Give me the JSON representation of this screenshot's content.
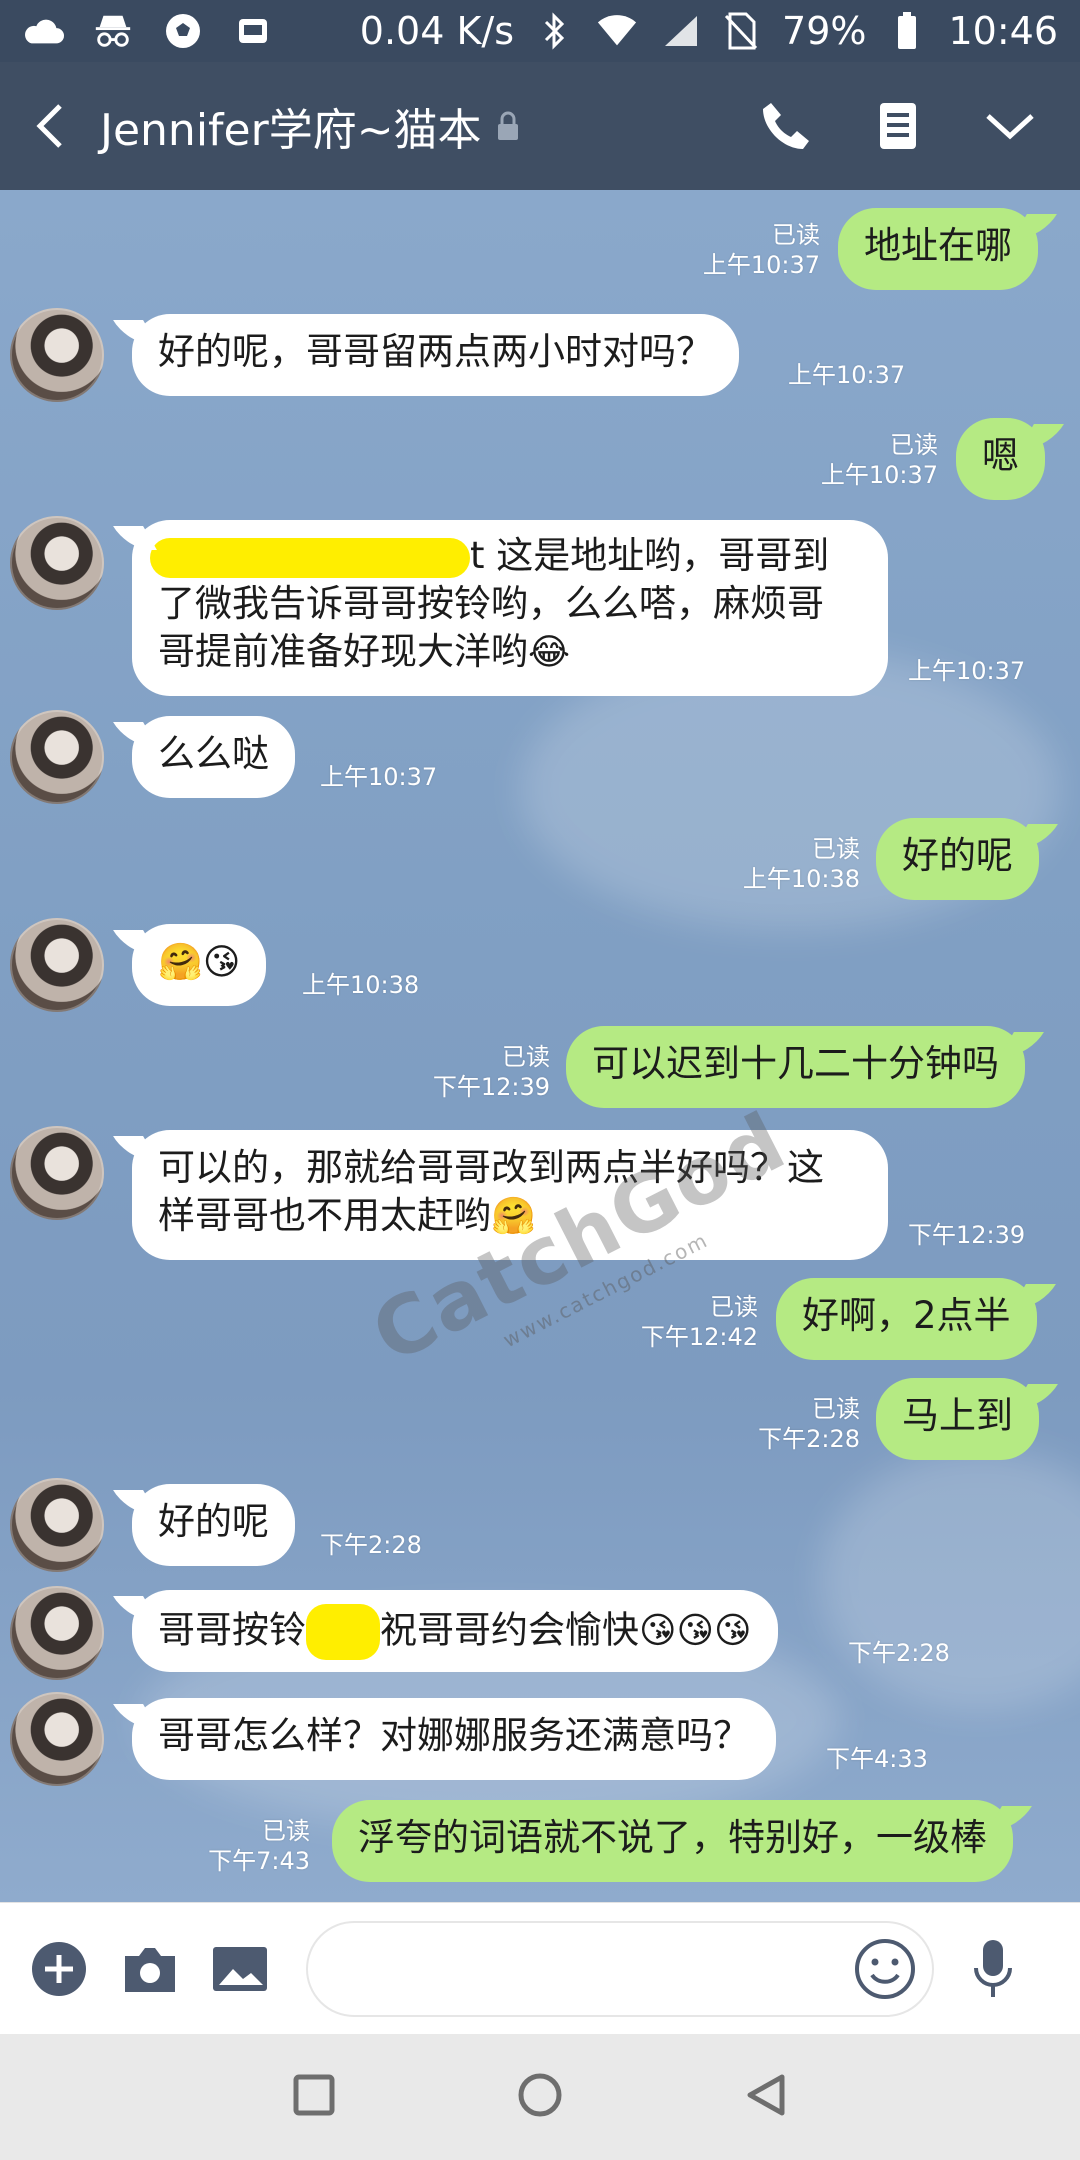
{
  "status_bar": {
    "net_speed": "0.04 K/s",
    "battery": "79%",
    "time": "10:46",
    "left_icons": [
      "cloud-icon",
      "incognito-icon",
      "soccer-ball-icon",
      "mail-icon"
    ]
  },
  "header": {
    "title": "Jennifer学府~猫本"
  },
  "messages": [
    {
      "side": "out",
      "text": "地址在哪",
      "read": "已读",
      "time": "上午10:37"
    },
    {
      "side": "in",
      "text": "好的呢，哥哥留两点两小时对吗？",
      "time": "上午10:37"
    },
    {
      "side": "out",
      "text": "嗯",
      "read": "已读",
      "time": "上午10:37"
    },
    {
      "side": "in",
      "text_line1_tail": "t 这是地址哟，哥哥到",
      "text_line2": "了微我告诉哥哥按铃哟，么么嗒，麻烦哥",
      "text_line3": "哥提前准备好现大洋哟",
      "emoji": "😂",
      "time": "上午10:37"
    },
    {
      "side": "in",
      "text": "么么哒",
      "time": "上午10:37"
    },
    {
      "side": "out",
      "text": "好的呢",
      "read": "已读",
      "time": "上午10:38"
    },
    {
      "side": "in",
      "text": "🤗😘",
      "time": "上午10:38"
    },
    {
      "side": "out",
      "text": "可以迟到十几二十分钟吗",
      "read": "已读",
      "time": "下午12:39"
    },
    {
      "side": "in",
      "text_line1": "可以的，那就给哥哥改到两点半好吗？这",
      "text_line2": "样哥哥也不用太赶哟",
      "emoji": "🤗",
      "time": "下午12:39"
    },
    {
      "side": "out",
      "text": "好啊，2点半",
      "read": "已读",
      "time": "下午12:42"
    },
    {
      "side": "out",
      "text": "马上到",
      "read": "已读",
      "time": "下午2:28"
    },
    {
      "side": "in",
      "text": "好的呢",
      "time": "下午2:28"
    },
    {
      "side": "in",
      "text_head": "哥哥按铃",
      "text_tail": "祝哥哥约会愉快",
      "emoji": "😘😘😘",
      "time": "下午2:28"
    },
    {
      "side": "in",
      "text": "哥哥怎么样？对娜娜服务还满意吗？",
      "time": "下午4:33"
    },
    {
      "side": "out",
      "text": "浮夸的词语就不说了，特别好，一级棒",
      "read": "已读",
      "time": "下午7:43"
    }
  ],
  "watermark": {
    "brand": "CatchGod",
    "url": "www.catchgod.com"
  }
}
